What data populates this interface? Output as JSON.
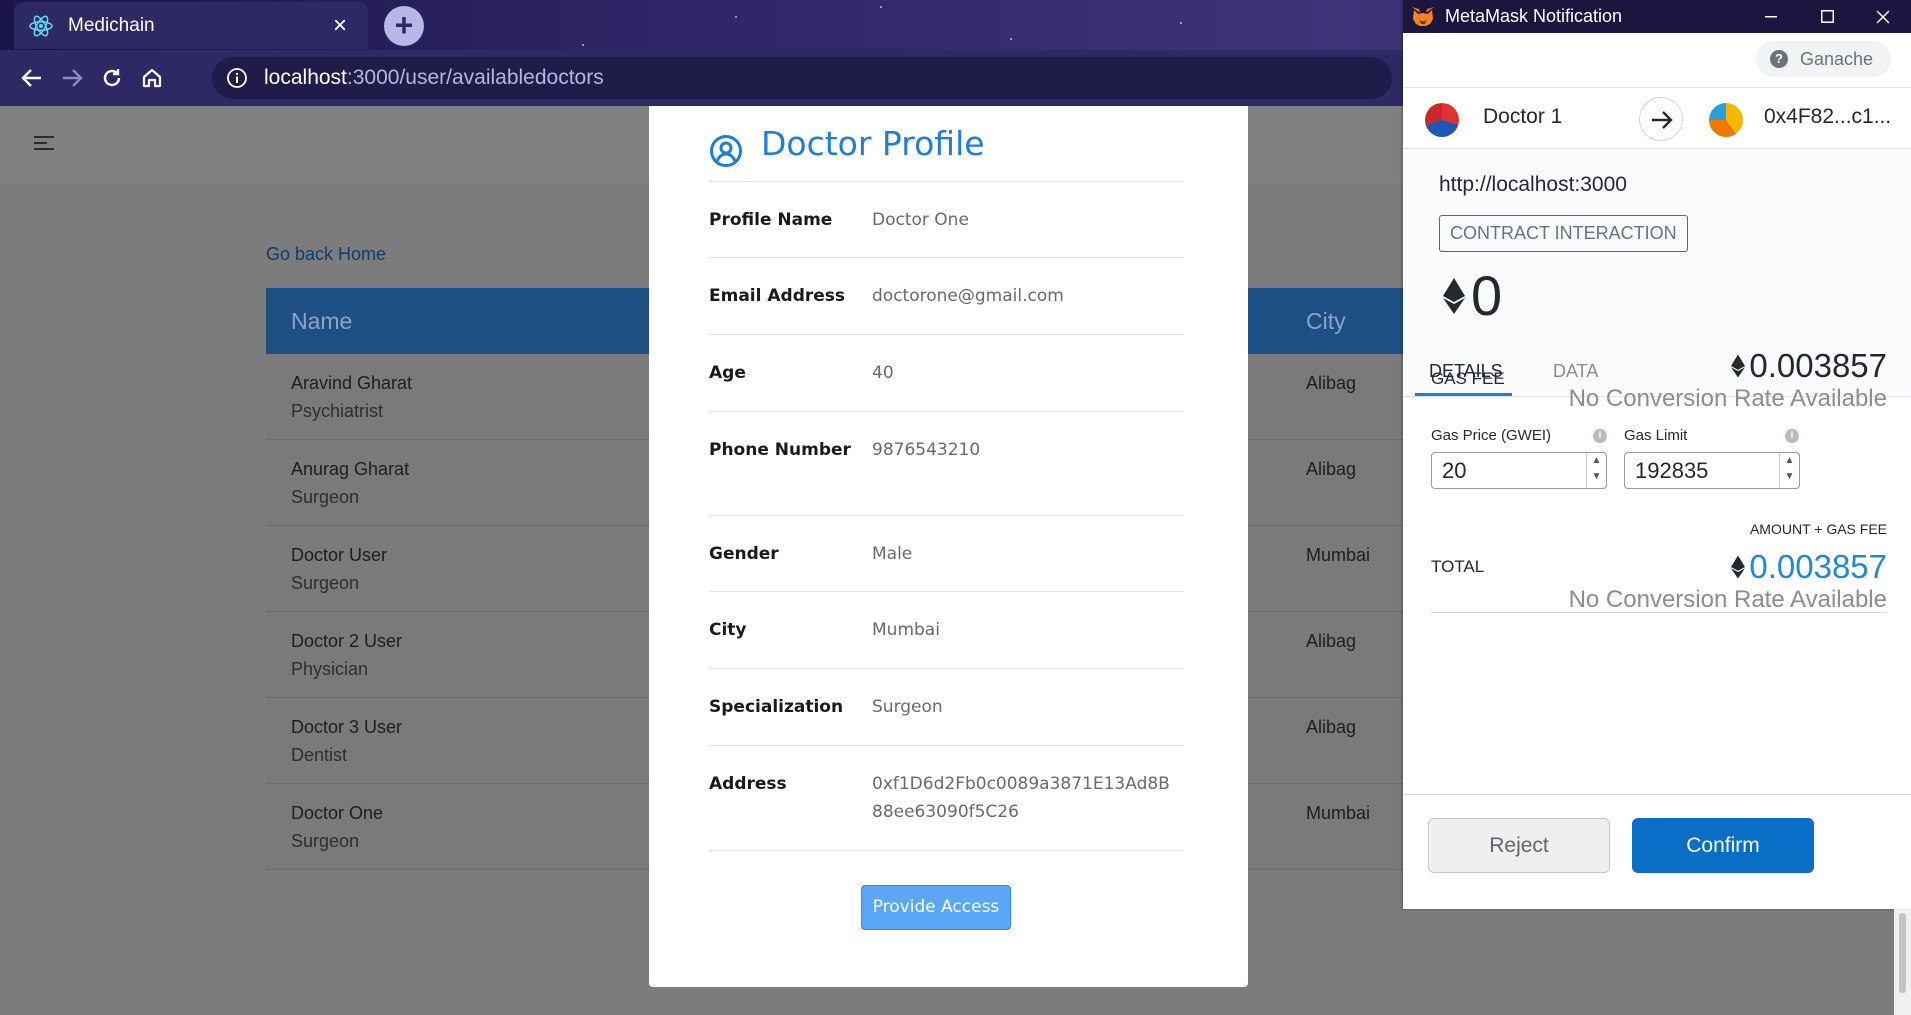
{
  "browser": {
    "tab_title": "Medichain",
    "tab_close": "×",
    "new_tab": "+",
    "url_host": "localhost",
    "url_path": ":3000/user/availabledoctors"
  },
  "page": {
    "back_link": "Go back Home",
    "columns": {
      "name": "Name",
      "city": "City"
    },
    "doctors": [
      {
        "name": "Aravind Gharat",
        "specialization": "Psychiatrist",
        "city": "Alibag"
      },
      {
        "name": "Anurag Gharat",
        "specialization": "Surgeon",
        "city": "Alibag"
      },
      {
        "name": "Doctor User",
        "specialization": "Surgeon",
        "city": "Mumbai"
      },
      {
        "name": "Doctor 2 User",
        "specialization": "Physician",
        "city": "Alibag"
      },
      {
        "name": "Doctor 3 User",
        "specialization": "Dentist",
        "city": "Alibag"
      },
      {
        "name": "Doctor One",
        "specialization": "Surgeon",
        "city": "Mumbai"
      }
    ]
  },
  "modal": {
    "title": "Doctor Profile",
    "fields": [
      {
        "label": "Profile Name",
        "value": "Doctor One"
      },
      {
        "label": "Email Address",
        "value": "doctorone@gmail.com"
      },
      {
        "label": "Age",
        "value": "40"
      },
      {
        "label": "Phone Number",
        "value": "9876543210"
      },
      {
        "label": "Gender",
        "value": "Male"
      },
      {
        "label": "City",
        "value": "Mumbai"
      },
      {
        "label": "Specialization",
        "value": "Surgeon"
      },
      {
        "label": "Address",
        "value": "0xf1D6d2Fb0c0089a3871E13Ad8B88ee63090f5C26"
      }
    ],
    "button": "Provide Access"
  },
  "metamask": {
    "window_title": "MetaMask Notification",
    "network": "Ganache",
    "from_account": "Doctor 1",
    "to_account": "0x4F82...c1...",
    "origin": "http://localhost:3000",
    "method": "CONTRACT INTERACTION",
    "amount": "0",
    "tabs": {
      "details": "DETAILS",
      "data": "DATA"
    },
    "gas_fee_label": "GAS FEE",
    "gas_fee": "0.003857",
    "no_conversion": "No Conversion Rate Available",
    "gas_price_label": "Gas Price (GWEI)",
    "gas_price": "20",
    "gas_limit_label": "Gas Limit",
    "gas_limit": "192835",
    "amount_gas_label": "AMOUNT + GAS FEE",
    "total_label": "TOTAL",
    "total": "0.003857",
    "reject": "Reject",
    "confirm": "Confirm",
    "accent": "#0a6dc6"
  }
}
